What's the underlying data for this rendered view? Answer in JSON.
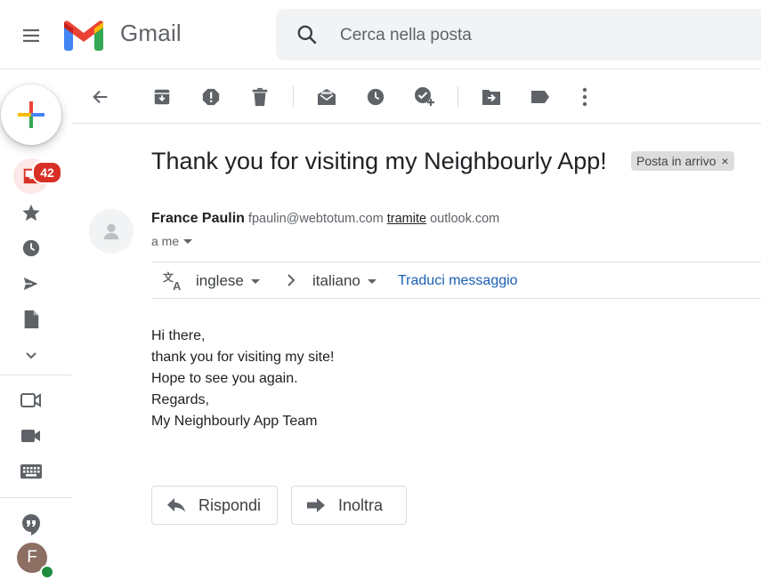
{
  "app": {
    "name": "Gmail"
  },
  "search": {
    "placeholder": "Cerca nella posta"
  },
  "leftrail": {
    "inbox_badge": "42",
    "avatar_letter": "F"
  },
  "email": {
    "subject": "Thank you for visiting my Neighbourly App!",
    "label": "Posta in arrivo",
    "label_remove": "×",
    "sender_name": "France Paulin",
    "sender_email": "fpaulin@webtotum.com",
    "via_text": "tramite",
    "via_domain": "outlook.com",
    "to": "a me",
    "body_lines": [
      "Hi there,",
      "thank you for visiting my site!",
      "Hope to see you again.",
      "Regards,",
      "My Neighbourly App Team"
    ]
  },
  "translate": {
    "source_lang": "inglese",
    "target_lang": "italiano",
    "action": "Traduci messaggio"
  },
  "actions": {
    "reply": "Rispondi",
    "forward": "Inoltra"
  },
  "colors": {
    "accent_red": "#d93025",
    "link_blue": "#1a5fb4",
    "icon_gray": "#5f6368"
  }
}
